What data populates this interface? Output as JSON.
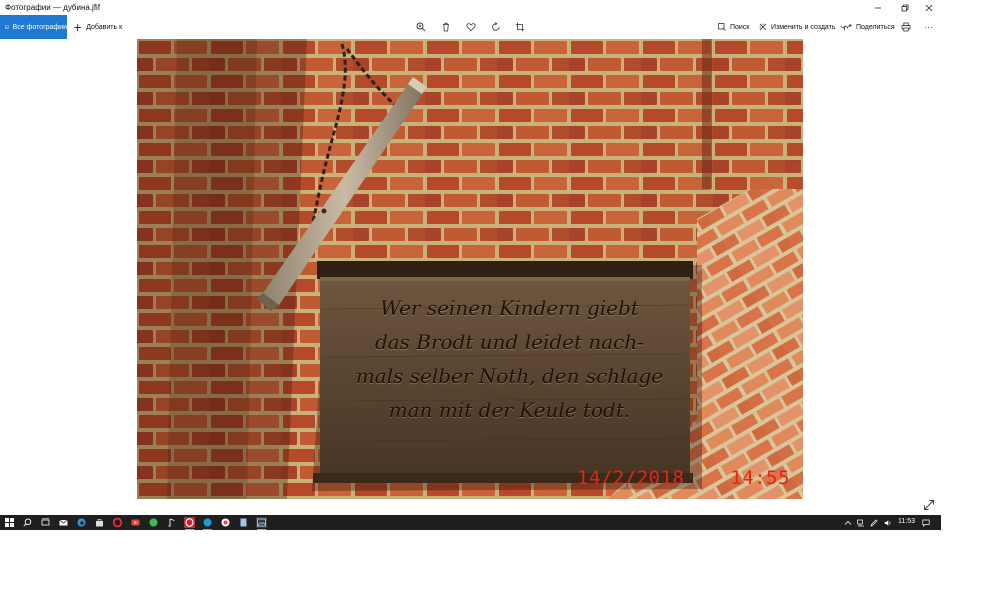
{
  "window": {
    "title": "Фотографии — дубина.jfif"
  },
  "toolbar": {
    "all_photos_label": "Все фотографии",
    "add_to_label": "Добавить к",
    "search_label": "Поиск",
    "edit_create_label": "Изменить и создать",
    "share_label": "Поделиться",
    "more_label": "···"
  },
  "photo": {
    "plaque_lines": [
      "Wer seinen Kindern giebt",
      "das Brodt und leidet nach-",
      "mals selber Noth, den schlage",
      "man mit der Keule todt."
    ],
    "date_stamp": "14/2/2018",
    "time_stamp": "14:55"
  },
  "taskbar": {
    "clock": "11:53"
  },
  "colors": {
    "accent": "#1f79d2",
    "taskbar": "#1f1f1f",
    "stamp": "#e42617"
  }
}
